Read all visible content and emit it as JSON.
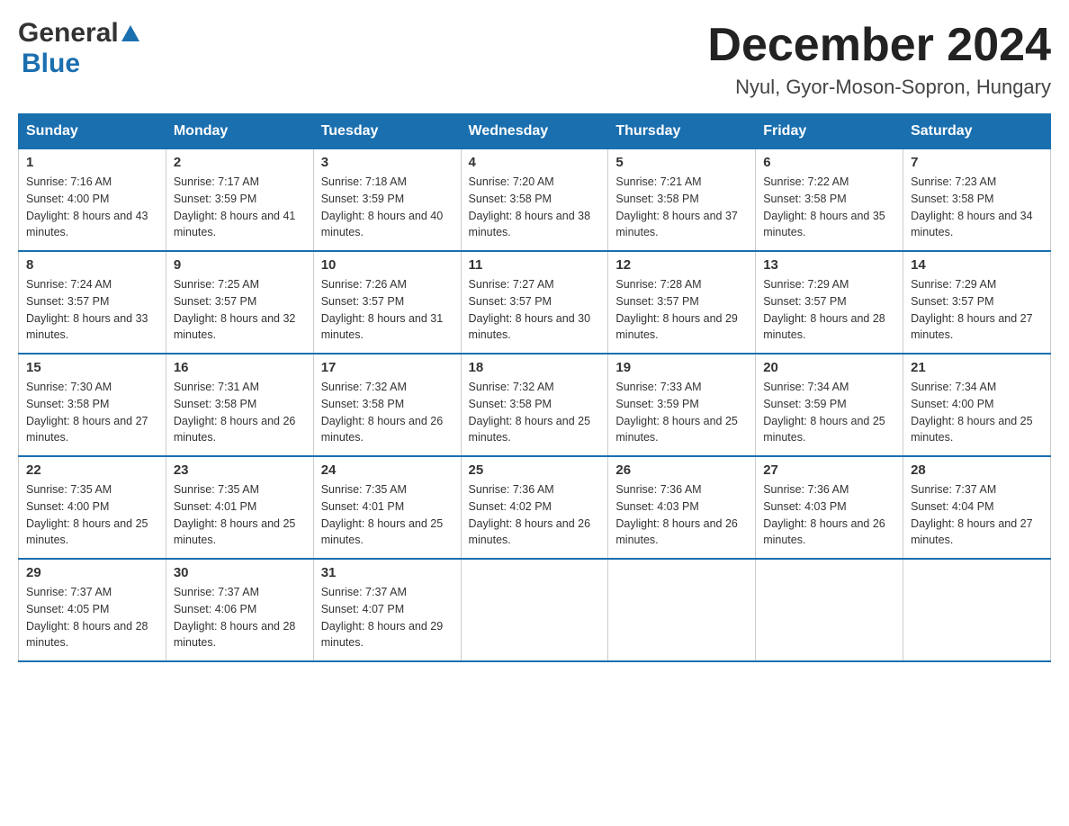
{
  "header": {
    "title": "December 2024",
    "subtitle": "Nyul, Gyor-Moson-Sopron, Hungary",
    "logo_general": "General",
    "logo_blue": "Blue"
  },
  "columns": [
    "Sunday",
    "Monday",
    "Tuesday",
    "Wednesday",
    "Thursday",
    "Friday",
    "Saturday"
  ],
  "weeks": [
    [
      {
        "day": "1",
        "sunrise": "7:16 AM",
        "sunset": "4:00 PM",
        "daylight": "8 hours and 43 minutes."
      },
      {
        "day": "2",
        "sunrise": "7:17 AM",
        "sunset": "3:59 PM",
        "daylight": "8 hours and 41 minutes."
      },
      {
        "day": "3",
        "sunrise": "7:18 AM",
        "sunset": "3:59 PM",
        "daylight": "8 hours and 40 minutes."
      },
      {
        "day": "4",
        "sunrise": "7:20 AM",
        "sunset": "3:58 PM",
        "daylight": "8 hours and 38 minutes."
      },
      {
        "day": "5",
        "sunrise": "7:21 AM",
        "sunset": "3:58 PM",
        "daylight": "8 hours and 37 minutes."
      },
      {
        "day": "6",
        "sunrise": "7:22 AM",
        "sunset": "3:58 PM",
        "daylight": "8 hours and 35 minutes."
      },
      {
        "day": "7",
        "sunrise": "7:23 AM",
        "sunset": "3:58 PM",
        "daylight": "8 hours and 34 minutes."
      }
    ],
    [
      {
        "day": "8",
        "sunrise": "7:24 AM",
        "sunset": "3:57 PM",
        "daylight": "8 hours and 33 minutes."
      },
      {
        "day": "9",
        "sunrise": "7:25 AM",
        "sunset": "3:57 PM",
        "daylight": "8 hours and 32 minutes."
      },
      {
        "day": "10",
        "sunrise": "7:26 AM",
        "sunset": "3:57 PM",
        "daylight": "8 hours and 31 minutes."
      },
      {
        "day": "11",
        "sunrise": "7:27 AM",
        "sunset": "3:57 PM",
        "daylight": "8 hours and 30 minutes."
      },
      {
        "day": "12",
        "sunrise": "7:28 AM",
        "sunset": "3:57 PM",
        "daylight": "8 hours and 29 minutes."
      },
      {
        "day": "13",
        "sunrise": "7:29 AM",
        "sunset": "3:57 PM",
        "daylight": "8 hours and 28 minutes."
      },
      {
        "day": "14",
        "sunrise": "7:29 AM",
        "sunset": "3:57 PM",
        "daylight": "8 hours and 27 minutes."
      }
    ],
    [
      {
        "day": "15",
        "sunrise": "7:30 AM",
        "sunset": "3:58 PM",
        "daylight": "8 hours and 27 minutes."
      },
      {
        "day": "16",
        "sunrise": "7:31 AM",
        "sunset": "3:58 PM",
        "daylight": "8 hours and 26 minutes."
      },
      {
        "day": "17",
        "sunrise": "7:32 AM",
        "sunset": "3:58 PM",
        "daylight": "8 hours and 26 minutes."
      },
      {
        "day": "18",
        "sunrise": "7:32 AM",
        "sunset": "3:58 PM",
        "daylight": "8 hours and 25 minutes."
      },
      {
        "day": "19",
        "sunrise": "7:33 AM",
        "sunset": "3:59 PM",
        "daylight": "8 hours and 25 minutes."
      },
      {
        "day": "20",
        "sunrise": "7:34 AM",
        "sunset": "3:59 PM",
        "daylight": "8 hours and 25 minutes."
      },
      {
        "day": "21",
        "sunrise": "7:34 AM",
        "sunset": "4:00 PM",
        "daylight": "8 hours and 25 minutes."
      }
    ],
    [
      {
        "day": "22",
        "sunrise": "7:35 AM",
        "sunset": "4:00 PM",
        "daylight": "8 hours and 25 minutes."
      },
      {
        "day": "23",
        "sunrise": "7:35 AM",
        "sunset": "4:01 PM",
        "daylight": "8 hours and 25 minutes."
      },
      {
        "day": "24",
        "sunrise": "7:35 AM",
        "sunset": "4:01 PM",
        "daylight": "8 hours and 25 minutes."
      },
      {
        "day": "25",
        "sunrise": "7:36 AM",
        "sunset": "4:02 PM",
        "daylight": "8 hours and 26 minutes."
      },
      {
        "day": "26",
        "sunrise": "7:36 AM",
        "sunset": "4:03 PM",
        "daylight": "8 hours and 26 minutes."
      },
      {
        "day": "27",
        "sunrise": "7:36 AM",
        "sunset": "4:03 PM",
        "daylight": "8 hours and 26 minutes."
      },
      {
        "day": "28",
        "sunrise": "7:37 AM",
        "sunset": "4:04 PM",
        "daylight": "8 hours and 27 minutes."
      }
    ],
    [
      {
        "day": "29",
        "sunrise": "7:37 AM",
        "sunset": "4:05 PM",
        "daylight": "8 hours and 28 minutes."
      },
      {
        "day": "30",
        "sunrise": "7:37 AM",
        "sunset": "4:06 PM",
        "daylight": "8 hours and 28 minutes."
      },
      {
        "day": "31",
        "sunrise": "7:37 AM",
        "sunset": "4:07 PM",
        "daylight": "8 hours and 29 minutes."
      },
      null,
      null,
      null,
      null
    ]
  ]
}
